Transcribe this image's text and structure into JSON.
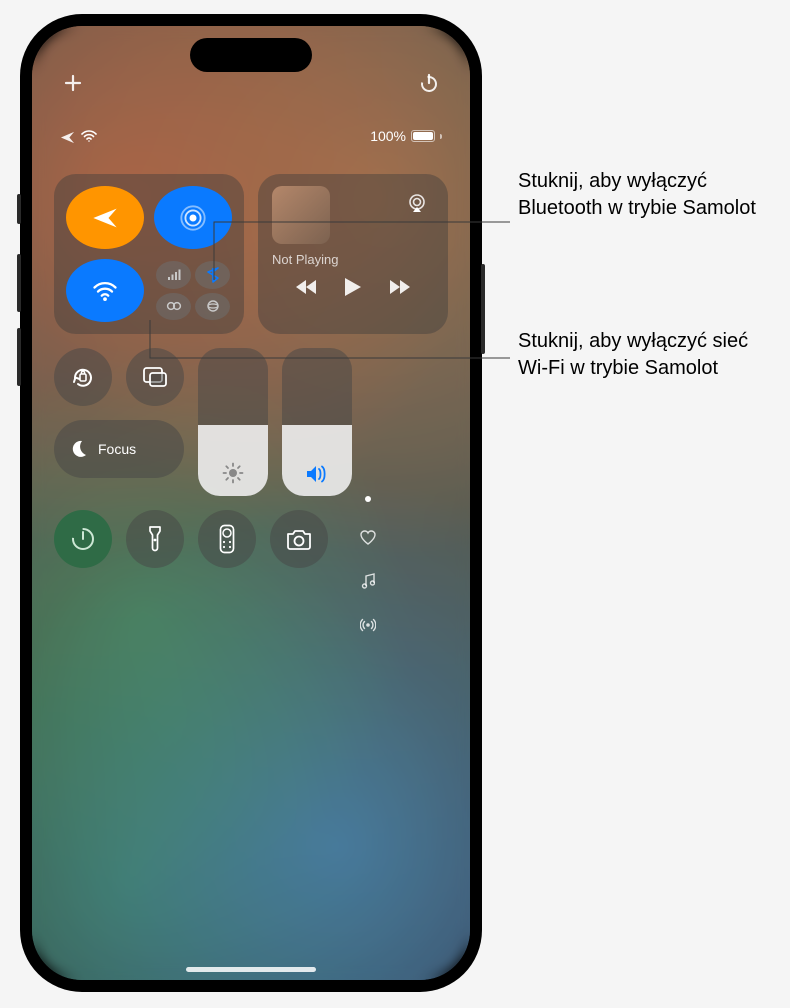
{
  "status": {
    "battery_text": "100%"
  },
  "connectivity": {
    "airplane": {
      "name": "airplane-mode",
      "on": true
    },
    "airdrop": {
      "name": "airdrop",
      "on": true
    },
    "wifi": {
      "name": "wifi",
      "on": true
    },
    "cellular_signal": {
      "name": "cellular-signal-icon"
    },
    "bluetooth": {
      "name": "bluetooth-icon"
    },
    "personal_hotspot": {
      "name": "personal-hotspot-icon"
    },
    "satellite": {
      "name": "satellite-icon"
    }
  },
  "media": {
    "now_playing_label": "Not Playing"
  },
  "focus": {
    "label": "Focus"
  },
  "sliders": {
    "brightness_percent": 48,
    "volume_percent": 48
  },
  "side_indicators": {
    "heart": "heart-icon",
    "music": "music-note-icon",
    "broadcast": "broadcast-icon"
  },
  "bottom_row": {
    "timer": "timer-icon",
    "flashlight": "flashlight-icon",
    "remote": "apple-tv-remote-icon",
    "camera": "camera-icon"
  },
  "callouts": {
    "bluetooth": "Stuknij, aby wyłączyć Bluetooth w trybie Samolot",
    "wifi": "Stuknij, aby wyłączyć sieć Wi-Fi w trybie Samolot"
  }
}
